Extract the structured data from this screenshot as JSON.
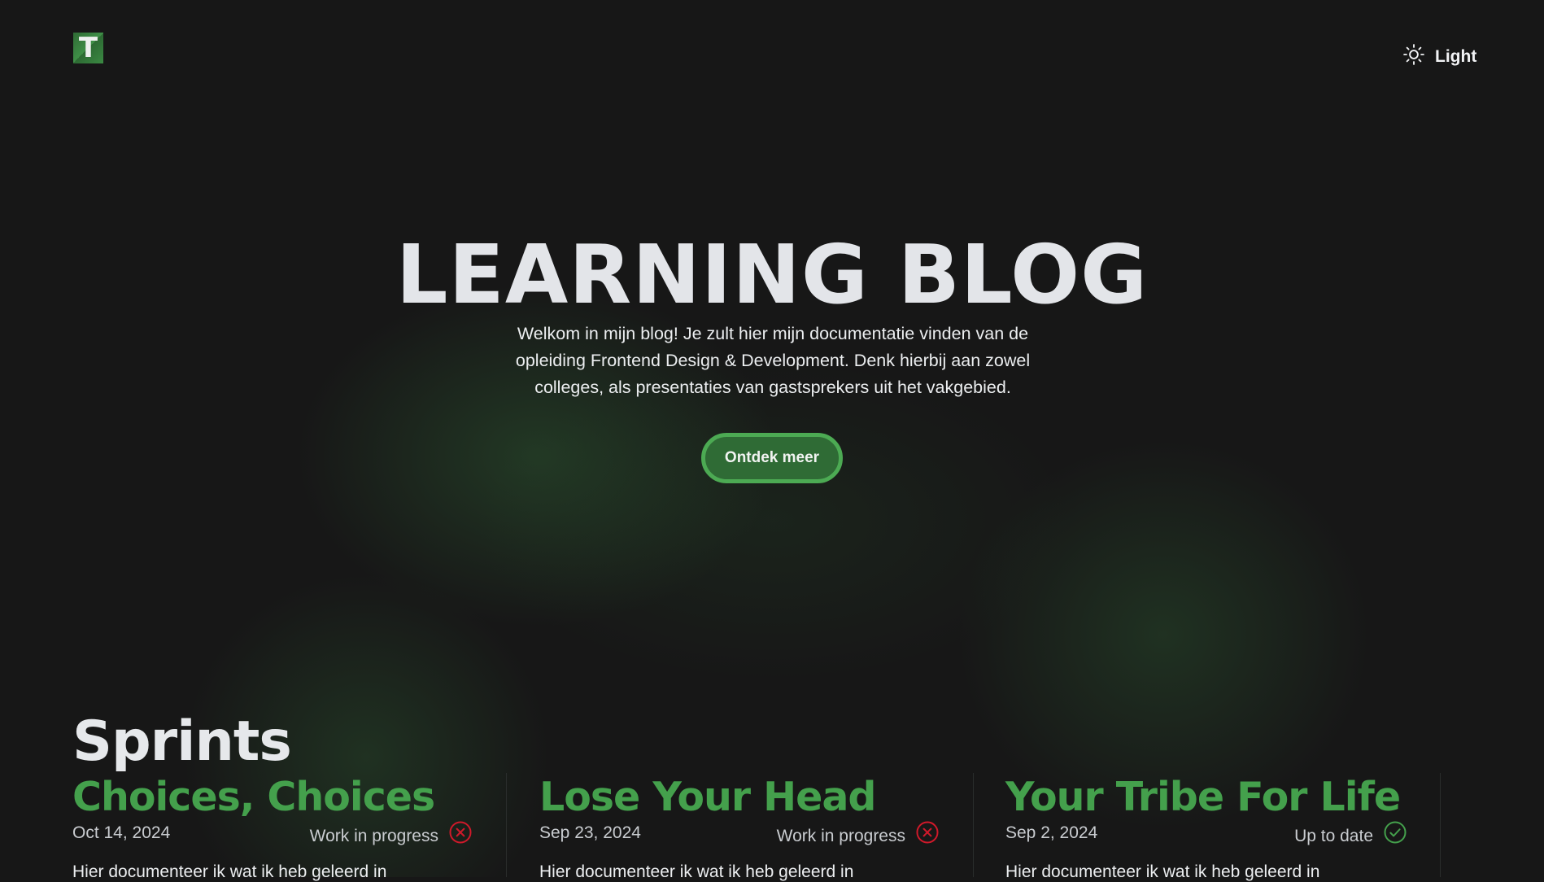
{
  "header": {
    "logo_letter": "T",
    "theme_toggle": {
      "icon": "sun-icon",
      "label": "Light"
    }
  },
  "hero": {
    "title": "LEARNING BLOG",
    "text": "Welkom in mijn blog! Je zult hier mijn documentatie vinden van de opleiding Frontend Design & Development. Denk hierbij aan zowel colleges, als presentaties van gastsprekers uit het vakgebied.",
    "cta_label": "Ontdek meer"
  },
  "sprints": {
    "title": "Sprints",
    "cards": [
      {
        "title": "Choices, Choices",
        "date": "Oct 14, 2024",
        "status": "Work in progress",
        "status_icon": "x-circle-icon",
        "excerpt": "Hier documenteer ik wat ik heb geleerd in"
      },
      {
        "title": "Lose Your Head",
        "date": "Sep 23, 2024",
        "status": "Work in progress",
        "status_icon": "x-circle-icon",
        "excerpt": "Hier documenteer ik wat ik heb geleerd in"
      },
      {
        "title": "Your Tribe For Life",
        "date": "Sep 2, 2024",
        "status": "Up to date",
        "status_icon": "check-circle-icon",
        "excerpt": "Hier documenteer ik wat ik heb geleerd in"
      }
    ]
  },
  "colors": {
    "background": "#171717",
    "accent_green": "#44a04c",
    "button_fill": "#2f6b35",
    "button_border": "#4caa53",
    "status_error": "#d0192a",
    "status_ok": "#44a04c"
  }
}
